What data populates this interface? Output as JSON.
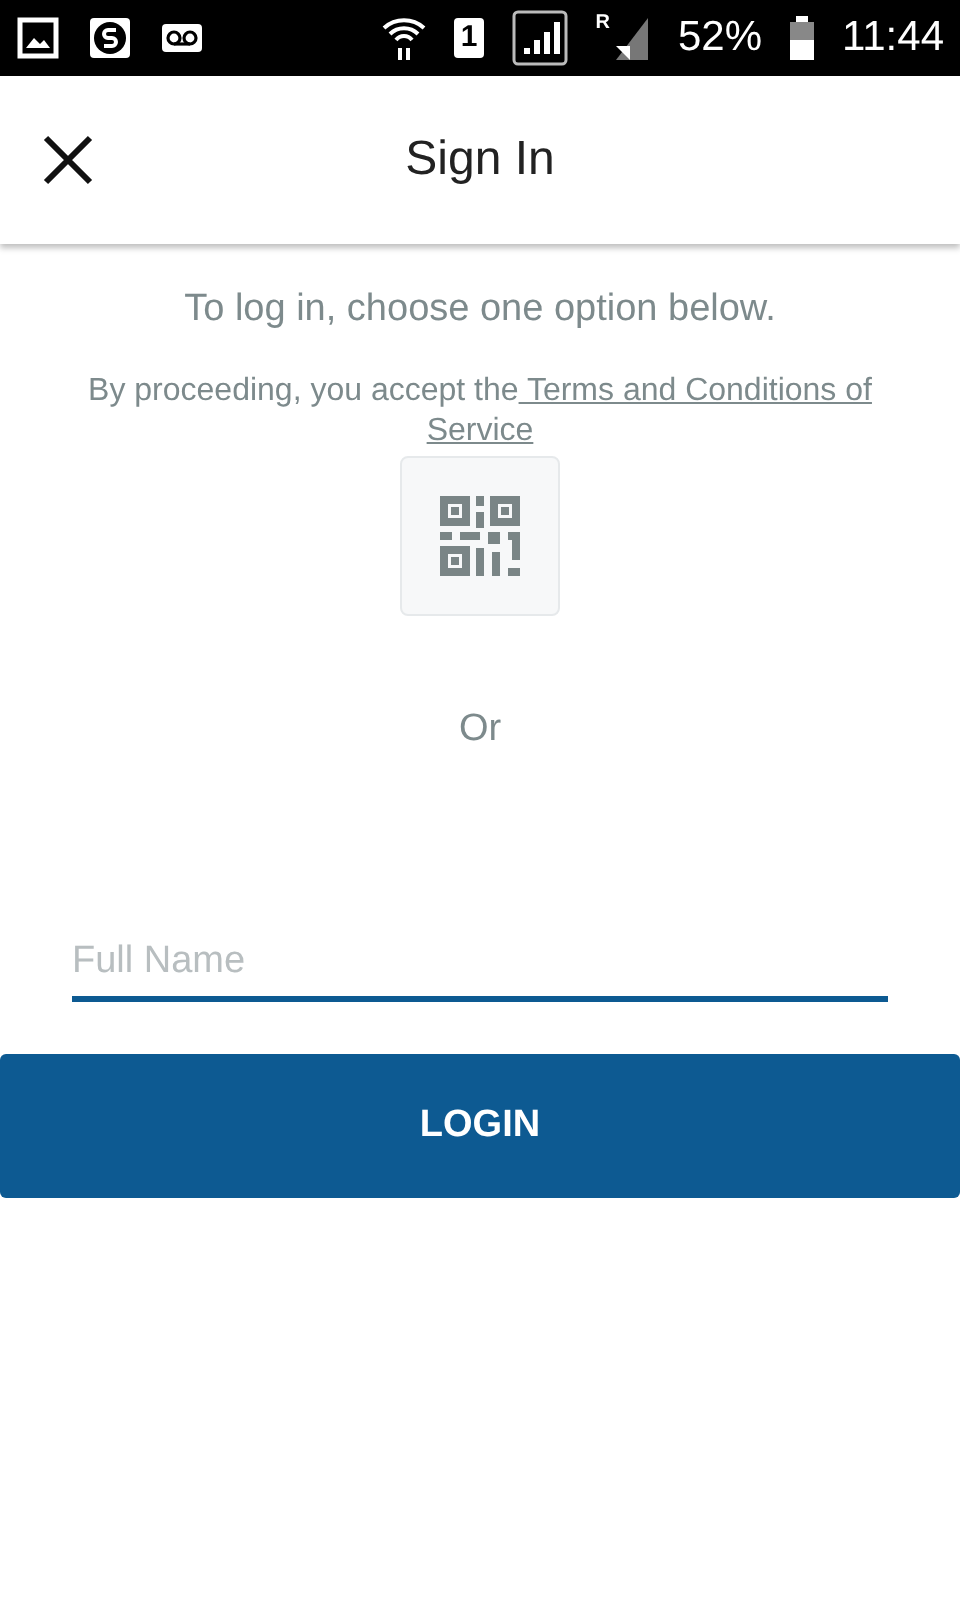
{
  "status_bar": {
    "sim_slot": "1",
    "roaming": "R",
    "battery": "52%",
    "time": "11:44"
  },
  "header": {
    "title": "Sign In"
  },
  "intro": "To log in, choose one option below.",
  "terms": {
    "prefix": "By proceeding, you accept the",
    "link_lines": [
      " Terms and Conditions of",
      "Service"
    ]
  },
  "separator": "Or",
  "name_field": {
    "placeholder": "Full Name"
  },
  "login_button": "LOGIN"
}
